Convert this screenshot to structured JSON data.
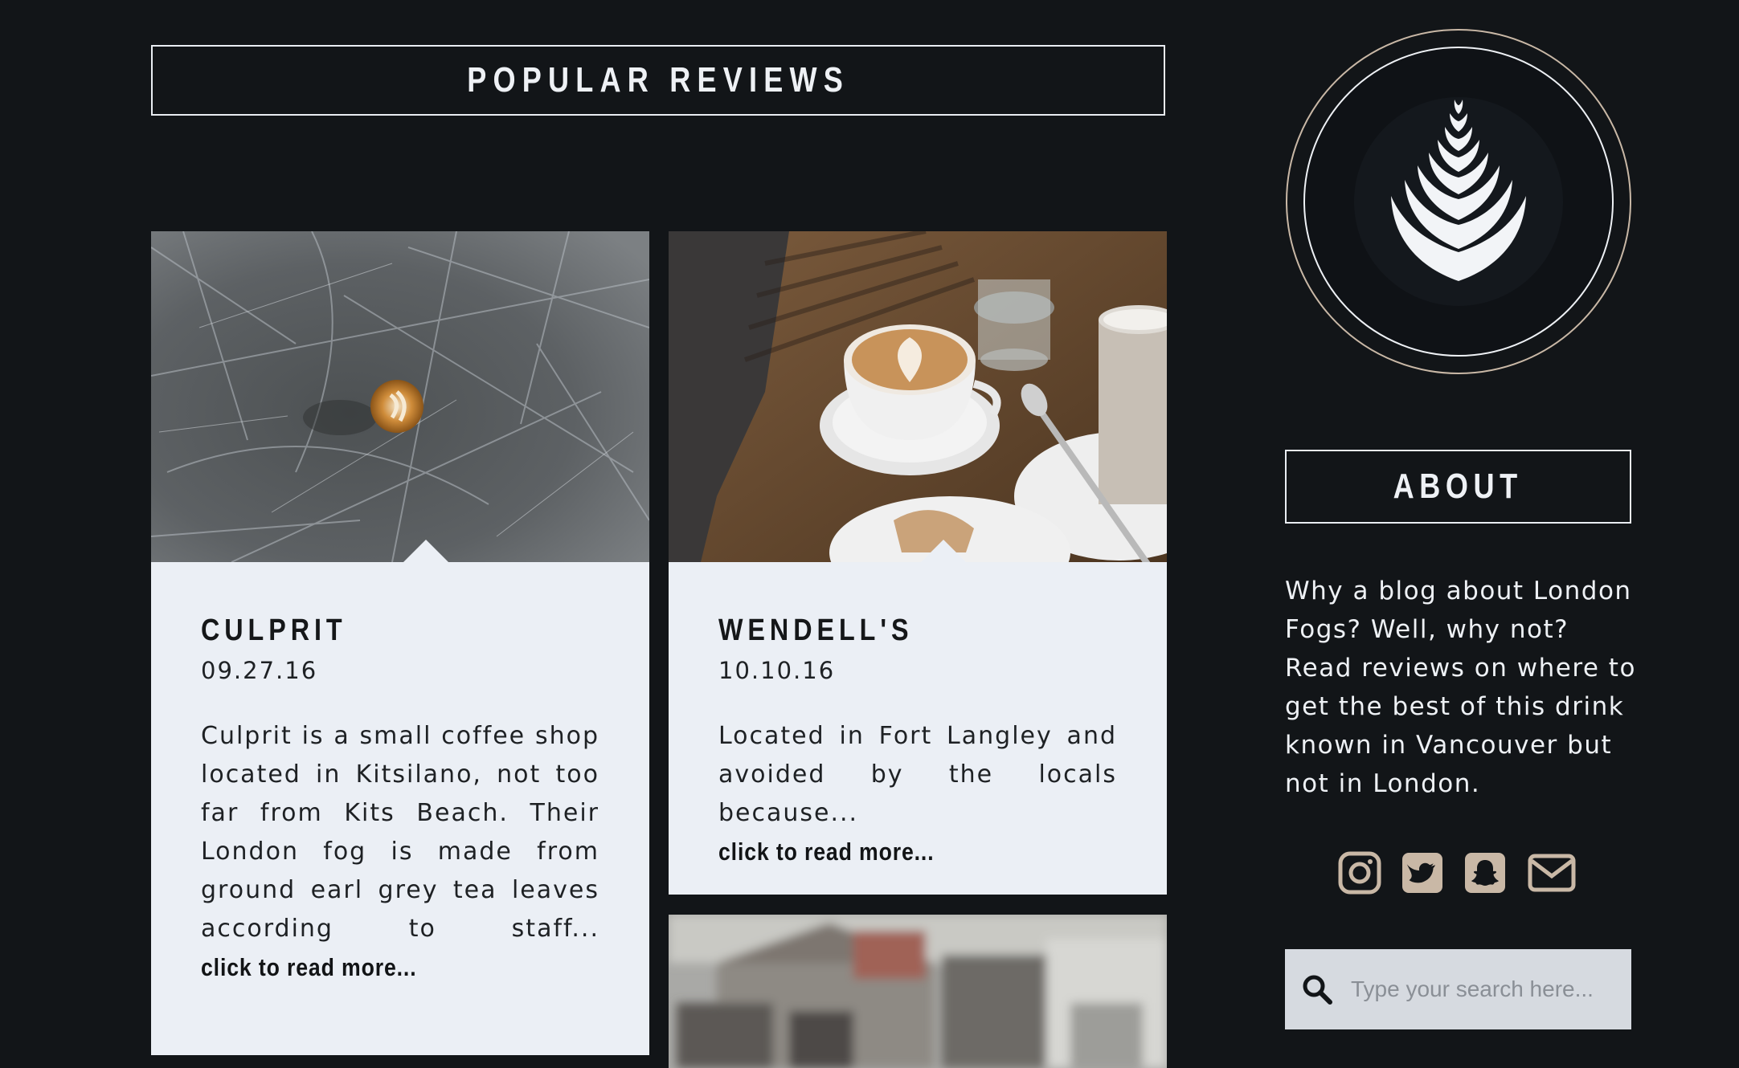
{
  "main": {
    "section_title": "POPULAR REVIEWS",
    "reviews": [
      {
        "title": "CULPRIT",
        "date": "09.27.16",
        "excerpt": "Culprit is a small coffee shop located in Kitsilano, not too far from Kits Beach. Their London fog is made from ground earl grey tea leaves according to staff...",
        "read_more": "click to read more..."
      },
      {
        "title": "WENDELL'S",
        "date": "10.10.16",
        "excerpt": "Located in Fort Langley and avoided by the locals because...",
        "read_more": "click to read more..."
      }
    ]
  },
  "sidebar": {
    "logo_icon": "latte-art-leaf-icon",
    "about_title": "ABOUT",
    "about_text": "Why a blog about London Fogs? Well, why not? Read reviews on where to get the best of this drink known in Vancouver but not in London.",
    "social": [
      "instagram-icon",
      "twitter-icon",
      "snapchat-icon",
      "email-icon"
    ],
    "search_placeholder": "Type your search here..."
  },
  "colors": {
    "background": "#121518",
    "card": "#ebeff5",
    "accent": "#c9b8a6",
    "search_bg": "#d6dae0"
  }
}
